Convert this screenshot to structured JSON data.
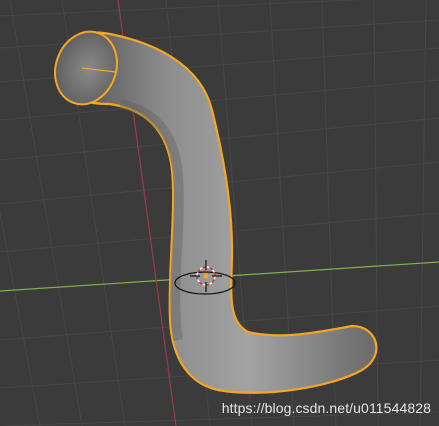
{
  "viewport": {
    "background_color": "#3b3b3b",
    "grid_color": "#474747",
    "x_axis_color": "#7fb24a",
    "y_axis_color": "#a0364a",
    "selection_outline_color": "#f5a623",
    "object_shape": "curved tube mesh",
    "object_selected": true,
    "gizmo_icon": "3d-cursor-icon"
  },
  "watermark": {
    "text": "https://blog.csdn.net/u011544828"
  }
}
